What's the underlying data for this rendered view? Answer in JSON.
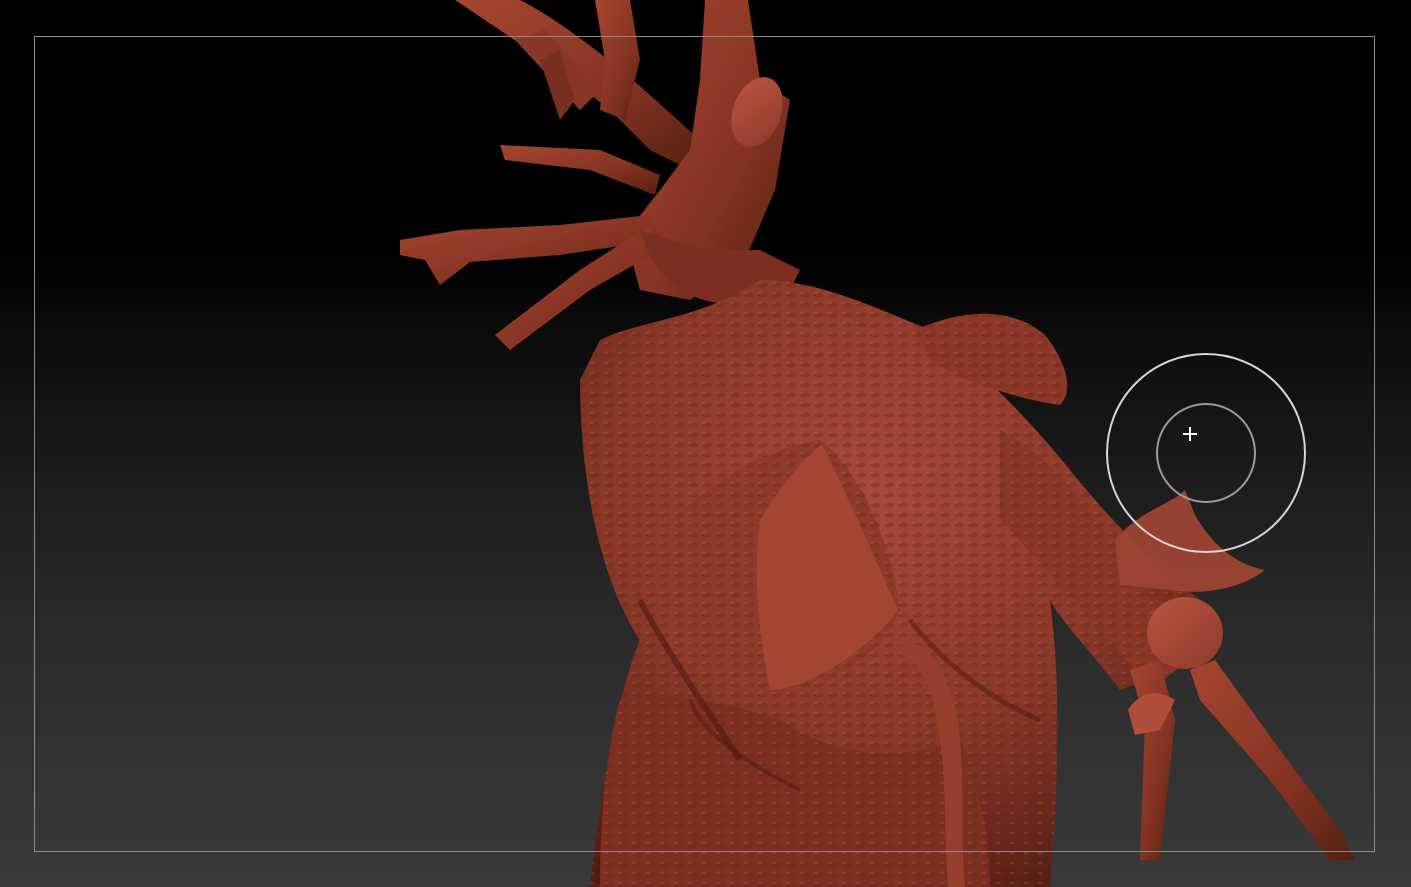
{
  "viewport": {
    "background_top": "#000000",
    "background_bottom": "#3a3a3a",
    "frame_color": "#8c8c8c"
  },
  "model": {
    "subject": "heart-sculpt",
    "base_color": "#8e3a2b",
    "highlight_color": "#b4503c",
    "shadow_color": "#4a1a12",
    "cap_color": "#a8483a"
  },
  "brush": {
    "outer_ring_color": "#d8d8d8",
    "inner_ring_color": "#9a9a9a",
    "cursor_icon": "crosshair-icon"
  }
}
